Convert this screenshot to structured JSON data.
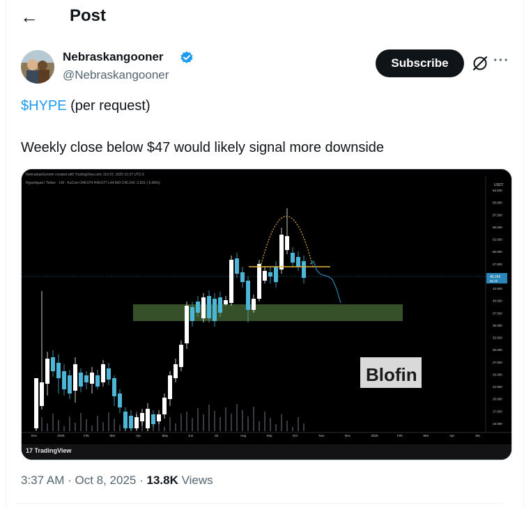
{
  "header": {
    "title": "Post"
  },
  "post": {
    "author_name": "Nebraskangooner",
    "author_handle": "@Nebraskangooner",
    "subscribe_label": "Subscribe",
    "cashtag": "$HYPE",
    "line1_rest": " (per request)",
    "line2": "Weekly close below $47 would likely signal more downside",
    "time": "3:37 AM",
    "sep": " · ",
    "date": "Oct 8, 2025",
    "views_count": "13.8K",
    "views_label": " Views"
  },
  "chart": {
    "top_caption": "NebraskanGooner created with TradingView.com, Oct 07, 2025 15:37 UTC-5",
    "symbol_line": "Hyperliquid / Tether · 1W · KuCoin  O48.074  H49.677  L44.500  C45.243  -2.831 (-5.89%)",
    "currency": "USDT",
    "price_ticks": [
      "62.500",
      "60.000",
      "57.500",
      "55.000",
      "52.500",
      "50.000",
      "47.500",
      "45.000",
      "42.500",
      "40.000",
      "37.500",
      "35.000",
      "32.500",
      "30.000",
      "27.500",
      "25.000",
      "22.500",
      "20.000",
      "17.500",
      "15.000"
    ],
    "current_price": "45.243",
    "current_price_sub": "5d 4h",
    "time_ticks": [
      "Dec",
      "2025",
      "Feb",
      "Mar",
      "Apr",
      "May",
      "Jun",
      "Jul",
      "Aug",
      "Sep",
      "Oct",
      "Nov",
      "Dec",
      "2026",
      "Feb",
      "Mar",
      "Apr",
      "Ma"
    ],
    "watermark": "Blofin",
    "brand": "TradingView",
    "colors": {
      "up": "#ffffff",
      "down": "#4db6d6",
      "zone": "#3c5a2e",
      "level": "#e2b23a",
      "arc": "#e2b23a",
      "projection": "#2a86b8"
    }
  }
}
